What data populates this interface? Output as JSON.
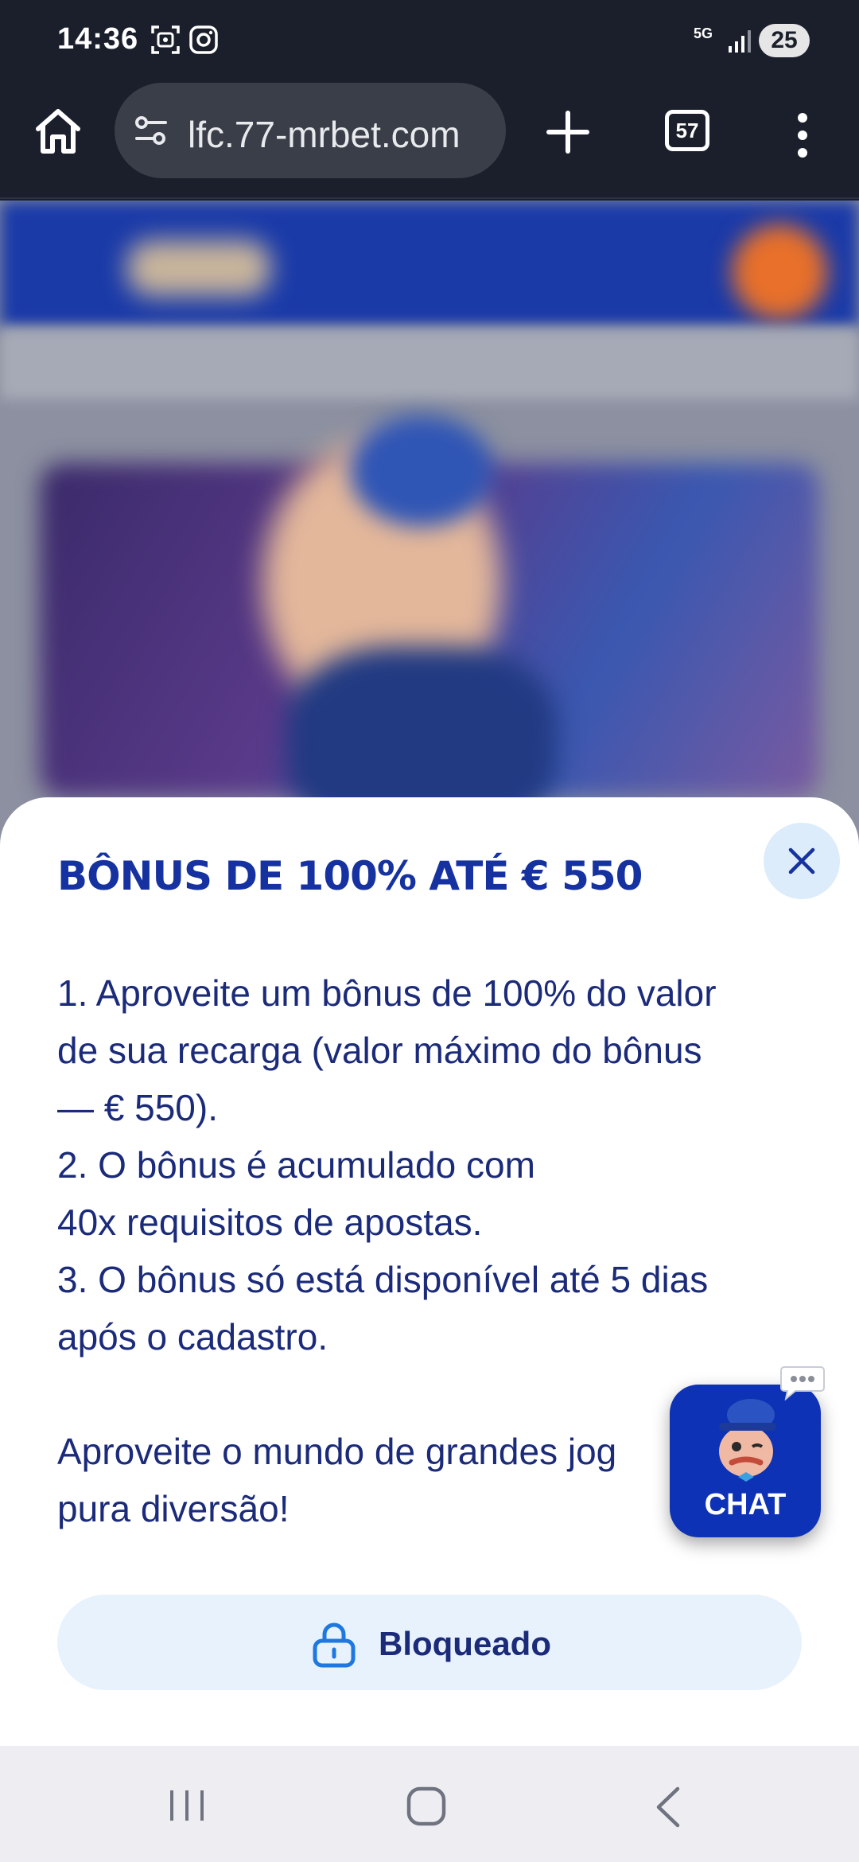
{
  "status_bar": {
    "time": "14:36",
    "network": "5G",
    "battery": "25",
    "icons": [
      "screenshot-icon",
      "instagram-icon",
      "signal-icon"
    ]
  },
  "browser": {
    "url": "lfc.77-mrbet.com",
    "tab_count": "57",
    "icons": [
      "home-icon",
      "site-settings-icon",
      "new-tab-icon",
      "more-icon"
    ]
  },
  "sheet": {
    "title": "BÔNUS DE 100% ATÉ € 550",
    "lines": [
      "1. Aproveite um bônus de 100% do valor",
      "de sua recarga (valor máximo do bônus",
      "— € 550).",
      "2. O bônus é acumulado com",
      "40x requisitos de apostas.",
      "3. O bônus só está disponível até 5 dias",
      "após o cadastro."
    ],
    "outro_lines": [
      "Aproveite o mundo de grandes jog",
      "pura diversão!"
    ],
    "lock_button_label": "Bloqueado"
  },
  "chat": {
    "label": "CHAT"
  },
  "colors": {
    "brand_blue": "#1632a0",
    "chat_blue": "#0d32b5",
    "light_blue": "#e8f2fd",
    "text_blue": "#1b2b7a"
  }
}
